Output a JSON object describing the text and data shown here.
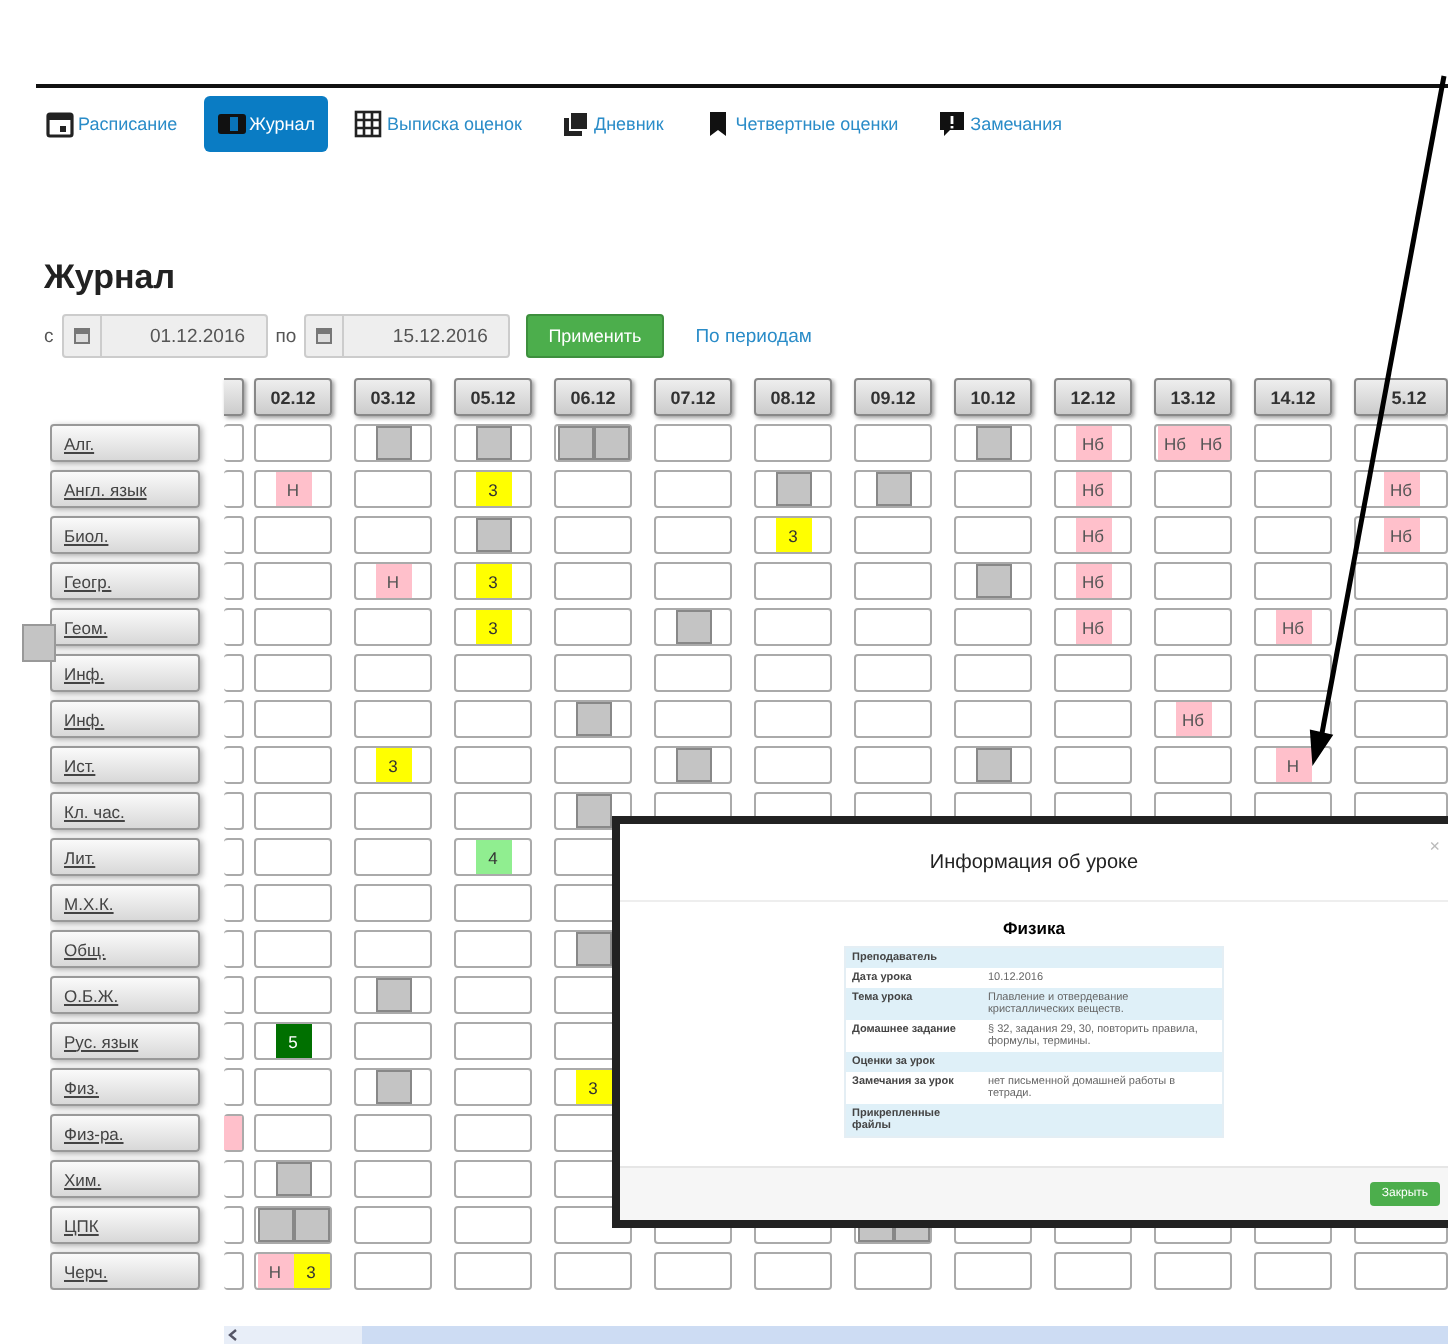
{
  "nav": {
    "tabs": [
      {
        "label": "Расписание",
        "selected": false
      },
      {
        "label": "Журнал",
        "selected": true
      },
      {
        "label": "Выписка оценок",
        "selected": false
      },
      {
        "label": "Дневник",
        "selected": false
      },
      {
        "label": "Четвертные оценки",
        "selected": false
      },
      {
        "label": "Замечания",
        "selected": false
      }
    ]
  },
  "title": "Журнал",
  "filter": {
    "from_label": "с",
    "from": "01.12.2016",
    "to_label": "по",
    "to": "15.12.2016",
    "apply": "Применить",
    "periods_link": "По периодам"
  },
  "journal": {
    "dates": [
      "02.12",
      "03.12",
      "05.12",
      "06.12",
      "07.12",
      "08.12",
      "09.12",
      "10.12",
      "12.12",
      "13.12",
      "14.12",
      "5.12"
    ],
    "rows": [
      {
        "subject": "Алг.",
        "cells": [
          [],
          [],
          [
            {
              "kind": "lesson"
            }
          ],
          [
            {
              "kind": "lesson"
            }
          ],
          [
            {
              "kind": "lesson"
            },
            {
              "kind": "lesson"
            }
          ],
          [],
          [],
          [],
          [
            {
              "kind": "lesson"
            }
          ],
          [
            {
              "kind": "absence",
              "text": "Нб"
            }
          ],
          [
            {
              "kind": "absence",
              "text": "Нб"
            },
            {
              "kind": "absence",
              "text": "Нб"
            }
          ],
          [],
          []
        ]
      },
      {
        "subject": "Англ. язык",
        "cells": [
          [],
          [
            {
              "kind": "absence",
              "text": "Н"
            }
          ],
          [],
          [
            {
              "kind": "grade",
              "text": "3",
              "color": "#ffff00"
            }
          ],
          [],
          [],
          [
            {
              "kind": "lesson"
            }
          ],
          [
            {
              "kind": "lesson"
            }
          ],
          [],
          [
            {
              "kind": "absence",
              "text": "Нб"
            }
          ],
          [],
          [],
          [
            {
              "kind": "absence",
              "text": "Нб"
            }
          ]
        ]
      },
      {
        "subject": "Биол.",
        "cells": [
          [],
          [],
          [],
          [
            {
              "kind": "lesson"
            }
          ],
          [],
          [],
          [
            {
              "kind": "grade",
              "text": "3",
              "color": "#ffff00"
            }
          ],
          [],
          [],
          [
            {
              "kind": "absence",
              "text": "Нб"
            }
          ],
          [],
          [],
          [
            {
              "kind": "absence",
              "text": "Нб"
            }
          ]
        ]
      },
      {
        "subject": "Геогр.",
        "cells": [
          [],
          [],
          [
            {
              "kind": "absence",
              "text": "Н"
            }
          ],
          [
            {
              "kind": "grade",
              "text": "3",
              "color": "#ffff00"
            }
          ],
          [],
          [],
          [],
          [],
          [
            {
              "kind": "lesson"
            }
          ],
          [
            {
              "kind": "absence",
              "text": "Нб"
            }
          ],
          [],
          [],
          []
        ]
      },
      {
        "subject": "Геом.",
        "cells": [
          [],
          [],
          [],
          [
            {
              "kind": "grade",
              "text": "3",
              "color": "#ffff00"
            }
          ],
          [],
          [
            {
              "kind": "lesson"
            }
          ],
          [],
          [],
          [],
          [
            {
              "kind": "absence",
              "text": "Нб"
            }
          ],
          [],
          [
            {
              "kind": "absence",
              "text": "Нб"
            }
          ],
          []
        ]
      },
      {
        "subject": "Инф.",
        "cells": [
          [],
          [],
          [],
          [],
          [],
          [],
          [],
          [],
          [],
          [],
          [],
          [],
          []
        ]
      },
      {
        "subject": "Инф.",
        "cells": [
          [],
          [],
          [],
          [],
          [
            {
              "kind": "lesson"
            }
          ],
          [],
          [],
          [],
          [],
          [],
          [
            {
              "kind": "absence",
              "text": "Нб"
            }
          ],
          [],
          []
        ]
      },
      {
        "subject": "Ист.",
        "cells": [
          [],
          [],
          [
            {
              "kind": "grade",
              "text": "3",
              "color": "#ffff00"
            }
          ],
          [],
          [],
          [
            {
              "kind": "lesson"
            }
          ],
          [],
          [],
          [
            {
              "kind": "lesson"
            }
          ],
          [],
          [],
          [
            {
              "kind": "absence",
              "text": "Н"
            }
          ],
          []
        ]
      },
      {
        "subject": "Кл. час.",
        "cells": [
          [],
          [],
          [],
          [],
          [
            {
              "kind": "lesson"
            }
          ],
          [],
          [],
          [],
          [],
          [],
          [],
          [],
          []
        ]
      },
      {
        "subject": "Лит.",
        "cells": [
          [],
          [],
          [],
          [
            {
              "kind": "grade",
              "text": "4",
              "color": "#90ee90"
            }
          ],
          [],
          [],
          [],
          [],
          [],
          [],
          [],
          [],
          []
        ]
      },
      {
        "subject": "М.Х.К.",
        "cells": [
          [],
          [],
          [],
          [],
          [],
          [],
          [],
          [],
          [],
          [],
          [],
          [],
          []
        ]
      },
      {
        "subject": "Общ.",
        "cells": [
          [],
          [],
          [],
          [],
          [
            {
              "kind": "lesson"
            }
          ],
          [],
          [],
          [],
          [],
          [],
          [],
          [],
          []
        ]
      },
      {
        "subject": "О.Б.Ж.",
        "cells": [
          [],
          [],
          [
            {
              "kind": "lesson"
            }
          ],
          [],
          [],
          [],
          [],
          [],
          [],
          [],
          [],
          [],
          []
        ]
      },
      {
        "subject": "Рус. язык",
        "cells": [
          [],
          [
            {
              "kind": "grade",
              "text": "5",
              "color": "#007000"
            }
          ],
          [],
          [],
          [],
          [],
          [],
          [],
          [],
          [],
          [],
          [],
          []
        ]
      },
      {
        "subject": "Физ.",
        "cells": [
          [],
          [],
          [
            {
              "kind": "lesson"
            }
          ],
          [],
          [
            {
              "kind": "grade",
              "text": "3",
              "color": "#ffff00"
            }
          ],
          [],
          [],
          [],
          [],
          [],
          [],
          [],
          []
        ]
      },
      {
        "subject": "Физ-ра.",
        "cells": [
          [
            {
              "kind": "absence"
            }
          ],
          [],
          [],
          [],
          [],
          [],
          [],
          [],
          [],
          [],
          [],
          [],
          []
        ]
      },
      {
        "subject": "Хим.",
        "cells": [
          [],
          [
            {
              "kind": "lesson"
            }
          ],
          [],
          [],
          [],
          [],
          [],
          [],
          [],
          [],
          [],
          [],
          []
        ]
      },
      {
        "subject": "ЦПК",
        "cells": [
          [],
          [
            {
              "kind": "lesson"
            },
            {
              "kind": "lesson"
            }
          ],
          [],
          [],
          [],
          [],
          [],
          [
            {
              "kind": "lesson"
            },
            {
              "kind": "lesson"
            }
          ],
          [],
          [],
          [],
          [],
          []
        ]
      },
      {
        "subject": "Черч.",
        "cells": [
          [],
          [
            {
              "kind": "absence",
              "text": "Н"
            },
            {
              "kind": "grade",
              "text": "3",
              "color": "#ffff00"
            }
          ],
          [],
          [],
          [],
          [],
          [],
          [],
          [],
          [],
          [],
          [],
          []
        ]
      }
    ]
  },
  "dialog": {
    "title": "Информация об уроке",
    "close": "×",
    "subject": "Физика",
    "fields": [
      {
        "label": "Преподаватель"
      },
      {
        "label": "Дата урока",
        "value": "10.12.2016"
      },
      {
        "label": "Тема урока",
        "value": "Плавление и отвердевание кристаллических веществ."
      },
      {
        "label": "Домашнее задание",
        "value": "§ 32, задания 29, 30, повторить правила, формулы, термины."
      },
      {
        "label": "Оценки за урок"
      },
      {
        "label": "Замечания за урок",
        "value": "нет письменной домашней работы в тетради."
      },
      {
        "label": "Прикрепленные файлы"
      }
    ],
    "button": "Закрыть"
  }
}
